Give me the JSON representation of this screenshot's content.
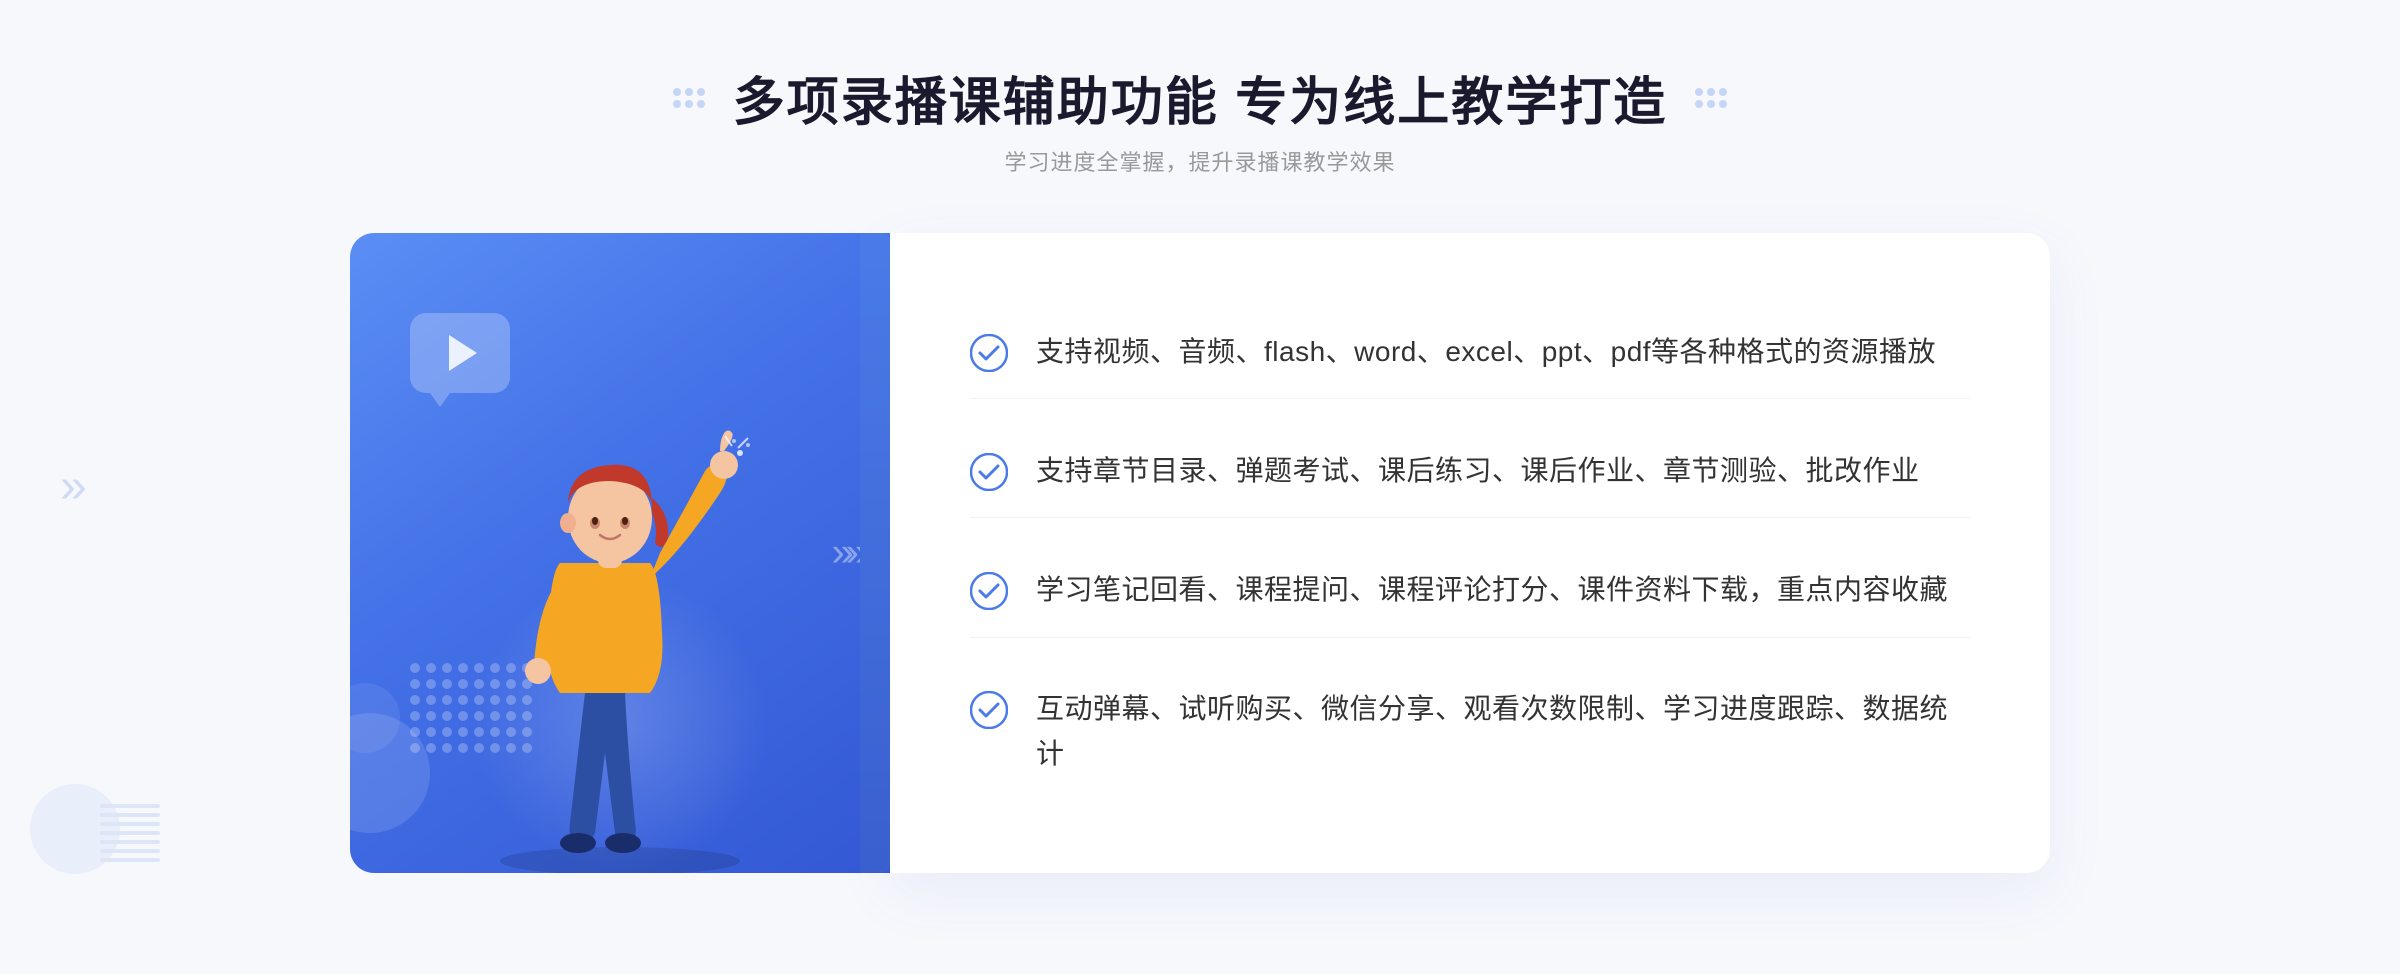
{
  "header": {
    "title": "多项录播课辅助功能 专为线上教学打造",
    "subtitle": "学习进度全掌握，提升录播课教学效果"
  },
  "features": [
    {
      "id": "feature-1",
      "text": "支持视频、音频、flash、word、excel、ppt、pdf等各种格式的资源播放"
    },
    {
      "id": "feature-2",
      "text": "支持章节目录、弹题考试、课后练习、课后作业、章节测验、批改作业"
    },
    {
      "id": "feature-3",
      "text": "学习笔记回看、课程提问、课程评论打分、课件资料下载，重点内容收藏"
    },
    {
      "id": "feature-4",
      "text": "互动弹幕、试听购买、微信分享、观看次数限制、学习进度跟踪、数据统计"
    }
  ],
  "colors": {
    "accent": "#4a7be8",
    "accent_dark": "#3358d4",
    "text_dark": "#1a1a2e",
    "text_gray": "#999999",
    "text_body": "#333333"
  }
}
